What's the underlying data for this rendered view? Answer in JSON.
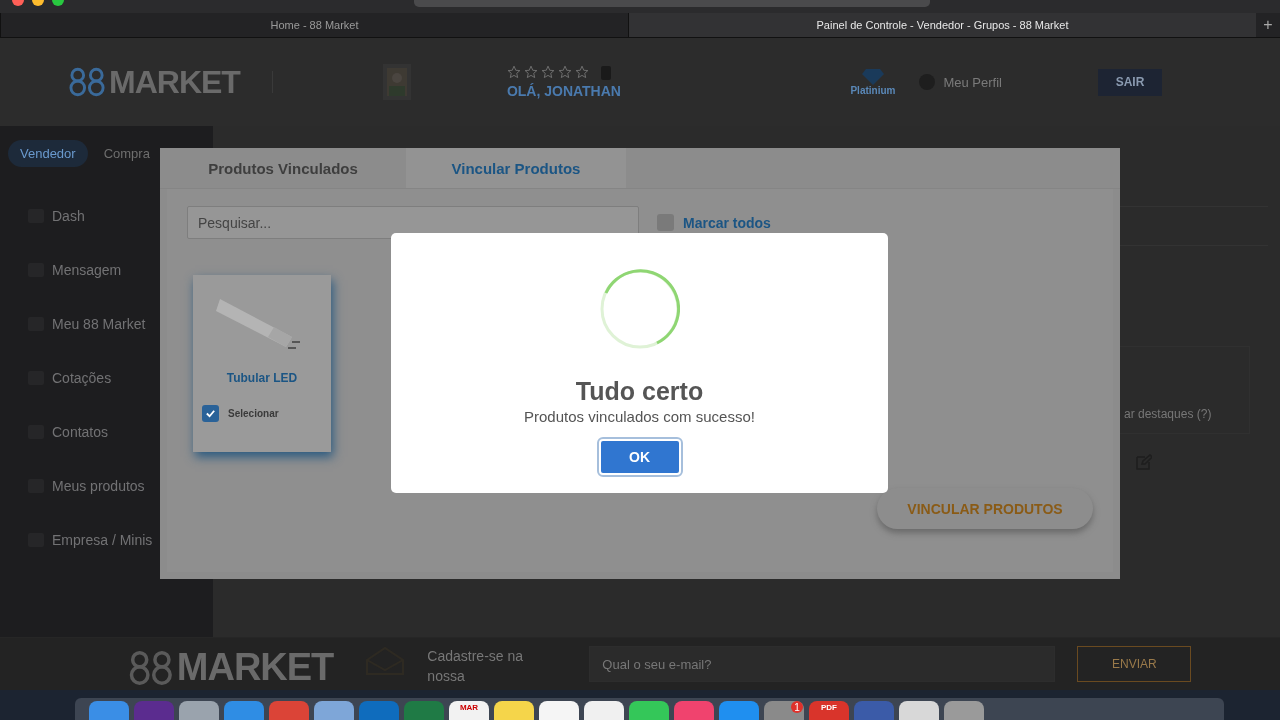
{
  "browser": {
    "tabs": [
      {
        "label": "Home - 88 Market",
        "selected": false
      },
      {
        "label": "Painel de Controle - Vendedor - Grupos - 88 Market",
        "selected": true
      }
    ],
    "new_tab": "+"
  },
  "header": {
    "logo": "MARKET",
    "stars": 0,
    "greeting": "OLÁ, JONATHAN",
    "tier": "Platinium",
    "profile": "Meu Perfil",
    "logout": "SAIR"
  },
  "sidebar": {
    "modes": [
      {
        "label": "Vendedor",
        "selected": true
      },
      {
        "label": "Compra",
        "selected": false
      }
    ],
    "items": [
      "Dash",
      "Mensagem",
      "Meu 88 Market",
      "Cotações",
      "Contatos",
      "Meus produtos",
      "Empresa / Minis"
    ]
  },
  "main": {
    "highlight_text": "ar destaques (?)"
  },
  "footer": {
    "logo": "MARKET",
    "signup": "Cadastre-se na nossa",
    "email_placeholder": "Qual o seu e-mail?",
    "submit": "ENVIAR"
  },
  "modal": {
    "tabs": [
      {
        "label": "Produtos Vinculados",
        "selected": false
      },
      {
        "label": "Vincular Produtos",
        "selected": true
      }
    ],
    "search_placeholder": "Pesquisar...",
    "select_all": {
      "label": "Marcar todos",
      "checked": false
    },
    "products": [
      {
        "name": "Tubular LED",
        "select_label": "Selecionar",
        "checked": true
      }
    ],
    "submit": "VINCULAR PRODUTOS"
  },
  "alert": {
    "title": "Tudo certo",
    "message": "Produtos vinculados com sucesso!",
    "confirm": "OK"
  },
  "dock": [
    {
      "color": "#3a8ee6"
    },
    {
      "color": "#5b2c8f"
    },
    {
      "color": "#9aa3ad"
    },
    {
      "color": "#2f8de4"
    },
    {
      "color": "#db4437"
    },
    {
      "color": "#7ea6d8"
    },
    {
      "color": "#0f6cbd"
    },
    {
      "color": "#1f7a45"
    },
    {
      "color": "#f2f2f2",
      "label": "MAR"
    },
    {
      "color": "#f5d54a"
    },
    {
      "color": "#f5f5f5"
    },
    {
      "color": "#f0f0f0"
    },
    {
      "color": "#34c759"
    },
    {
      "color": "#f0436e"
    },
    {
      "color": "#1f8ff0"
    },
    {
      "color": "#8a8a8a",
      "badge": "1"
    },
    {
      "color": "#d9342b",
      "label": "PDF"
    },
    {
      "color": "#3b5ba8"
    },
    {
      "color": "#d8d8d8"
    },
    {
      "color": "#9a9a9a"
    }
  ]
}
